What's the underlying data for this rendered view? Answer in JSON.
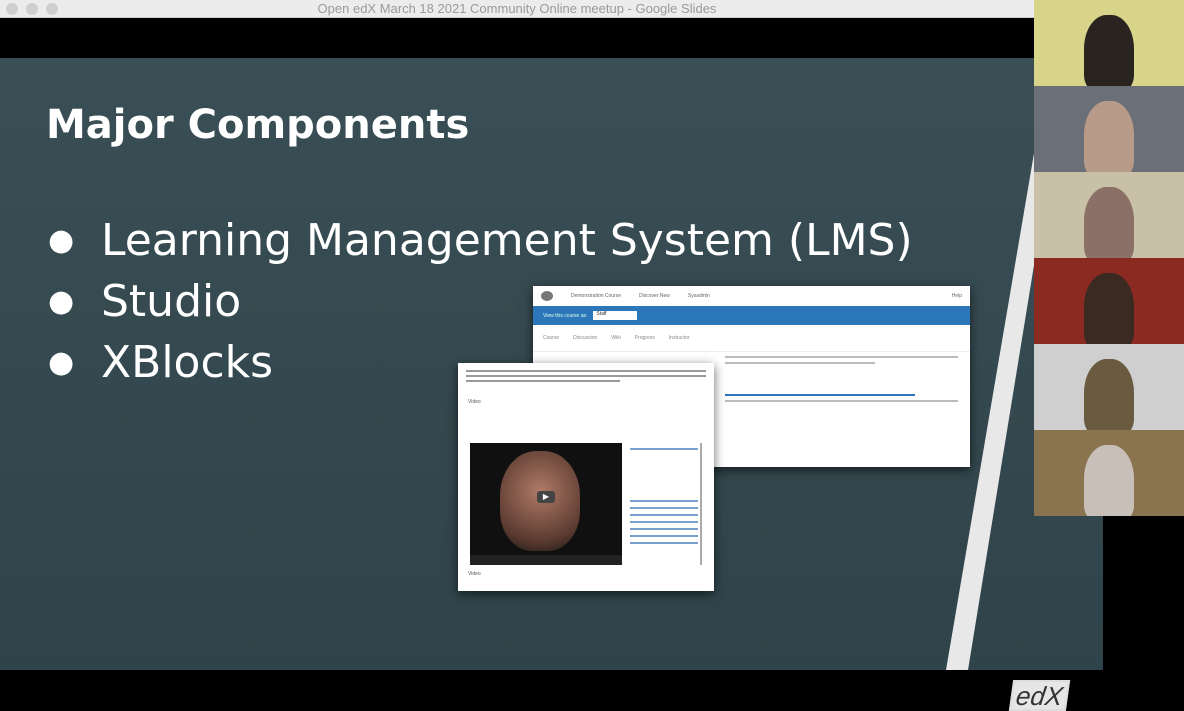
{
  "window": {
    "title": "Open edX March 18 2021 Community Online meetup - Google Slides"
  },
  "slide": {
    "title": "Major Components",
    "bullets": [
      "Learning Management System (LMS)",
      "Studio",
      "XBlocks"
    ],
    "logo": "edX"
  },
  "lms_screenshot": {
    "course": "Demonstration Course",
    "nav": [
      "Discover New",
      "Sysadmin"
    ],
    "help": "Help",
    "view_as_label": "View this course as:",
    "view_as_value": "Staff",
    "tabs": [
      "Course",
      "Discussion",
      "Wiki",
      "Progress",
      "Instructor"
    ]
  },
  "xblock_screenshot": {
    "section": "Video",
    "bottom_label": "Video"
  },
  "participants": 6
}
